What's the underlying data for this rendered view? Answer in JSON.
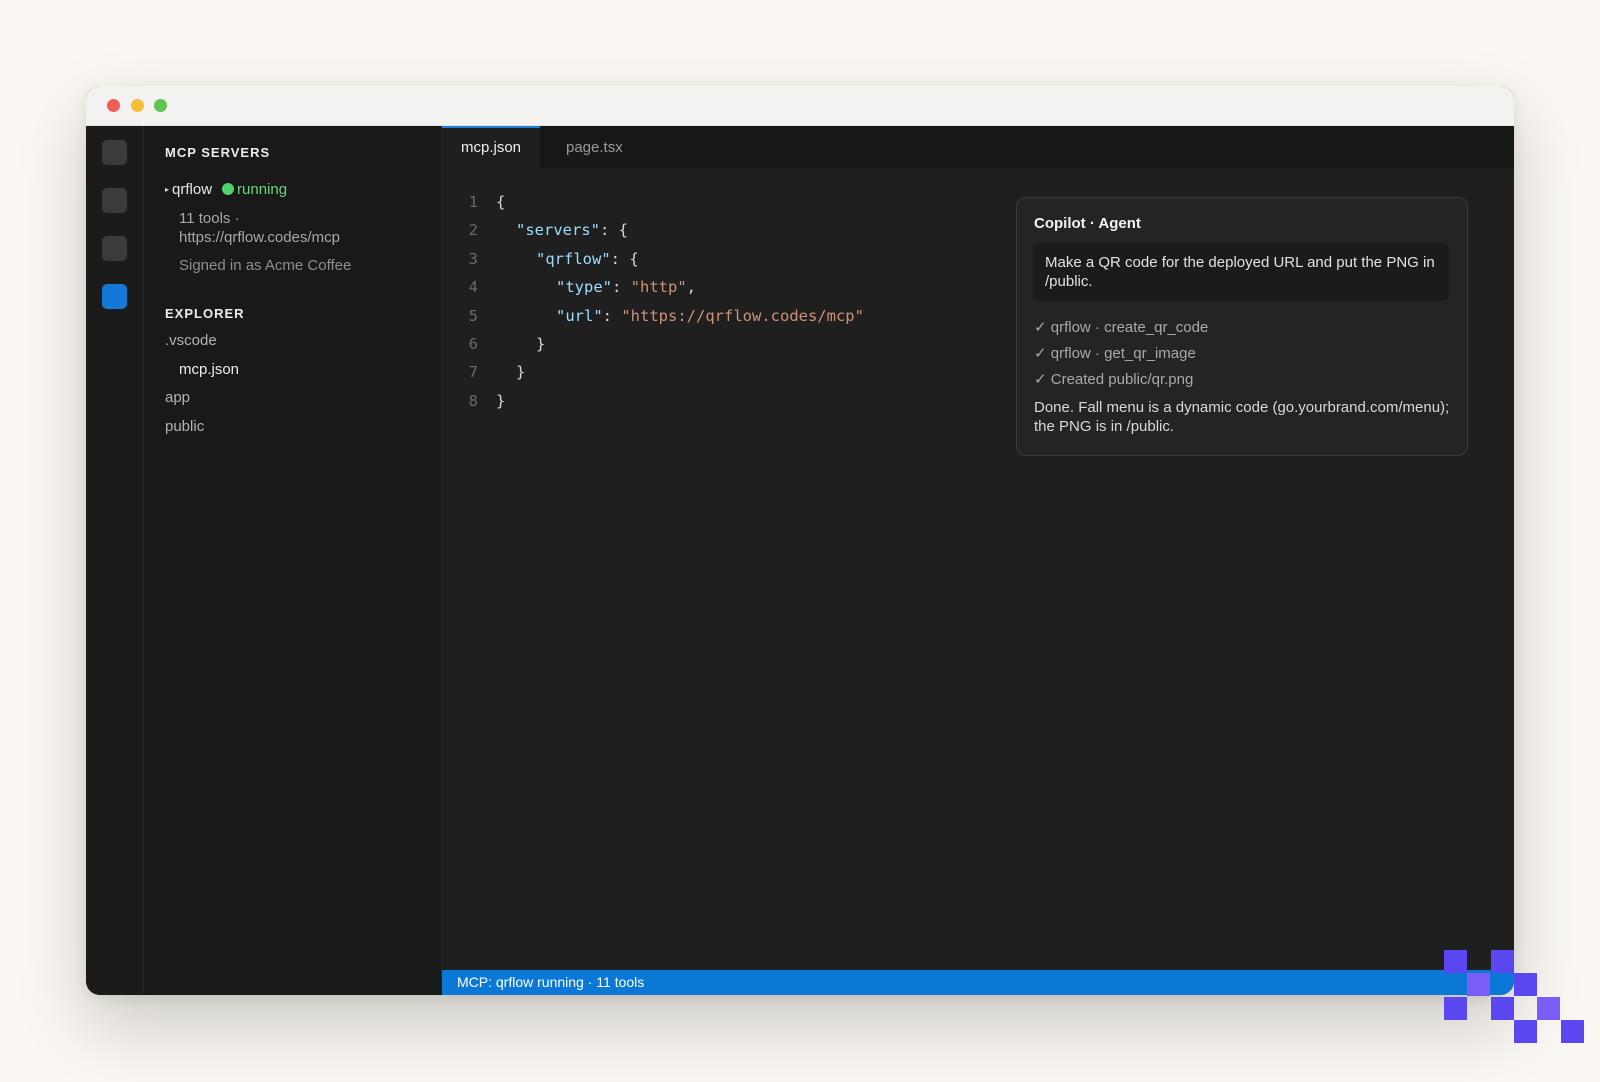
{
  "sidebar": {
    "mcp_title": "MCP SERVERS",
    "server": {
      "name": "qrflow",
      "status": "running",
      "tools": "11 tools ·",
      "url": "https://qrflow.codes/mcp",
      "signed_in": "Signed in as Acme Coffee"
    },
    "explorer_title": "EXPLORER",
    "tree": [
      ".vscode",
      "mcp.json",
      "app",
      "public"
    ]
  },
  "tabs": [
    "mcp.json",
    "page.tsx"
  ],
  "code": {
    "line_numbers": [
      "1",
      "2",
      "3",
      "4",
      "5",
      "6",
      "7",
      "8"
    ],
    "l1": "{",
    "l2_key": "\"servers\"",
    "l2_rest": ": {",
    "l3_key": "\"qrflow\"",
    "l3_rest": ": {",
    "l4_key": "\"type\"",
    "l4_colon": ": ",
    "l4_val": "\"http\"",
    "l4_end": ",",
    "l5_key": "\"url\"",
    "l5_colon": ": ",
    "l5_val": "\"https://qrflow.codes/mcp\"",
    "l6": "}",
    "l7": "}",
    "l8": "}"
  },
  "copilot": {
    "title": "Copilot · Agent",
    "prompt": "Make a QR code for the deployed URL and put the PNG in /public.",
    "steps": [
      "✓ qrflow · create_qr_code",
      "✓ qrflow · get_qr_image",
      "✓ Created public/qr.png"
    ],
    "result": "Done. Fall menu is a dynamic code (go.yourbrand.com/menu); the PNG is in /public."
  },
  "statusbar": {
    "text": "MCP: qrflow running · 11 tools"
  },
  "colors": {
    "accent": "#0a78d4",
    "running": "#4fd16b",
    "logo": "#5a47f0"
  }
}
